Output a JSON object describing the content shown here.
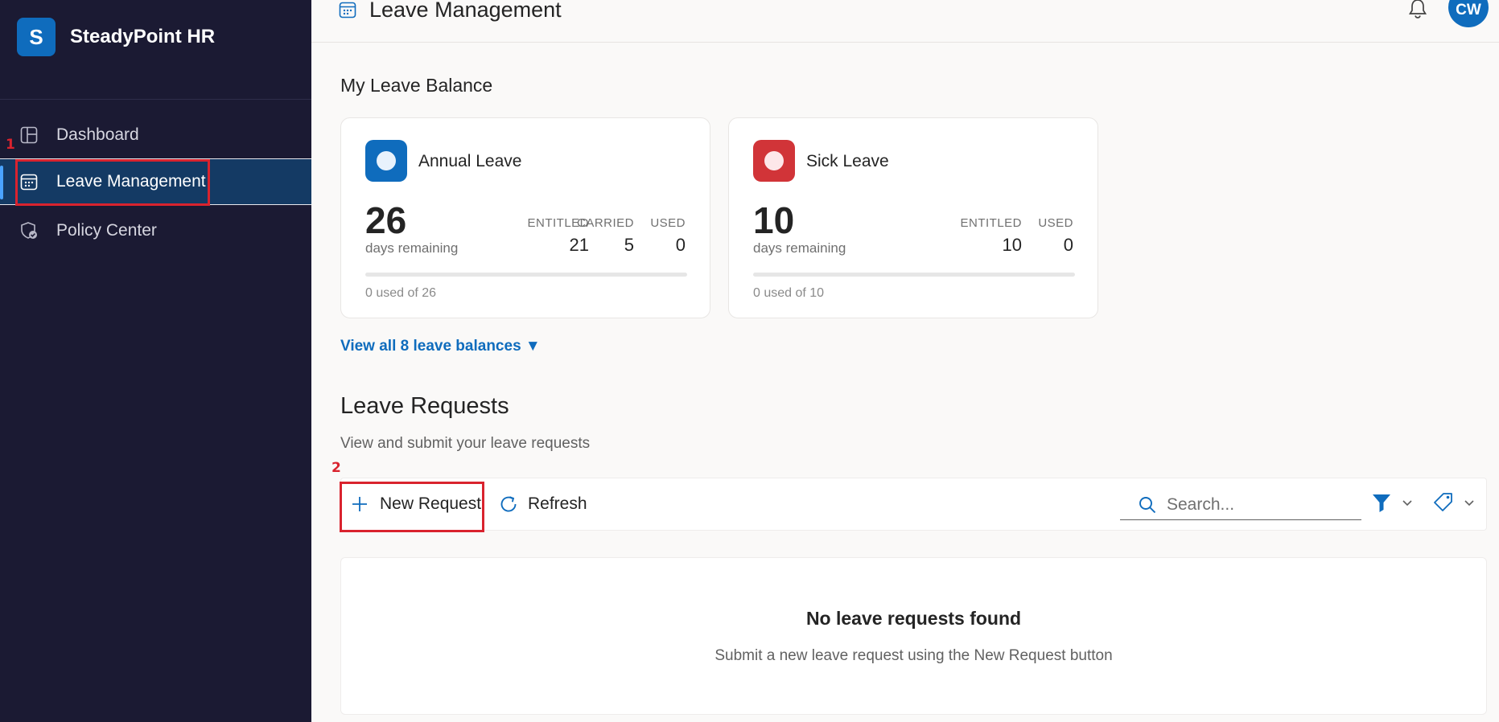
{
  "brand": {
    "logo_letter": "S",
    "name": "SteadyPoint HR"
  },
  "sidebar": {
    "items": [
      {
        "label": "Dashboard",
        "icon": "dashboard-icon"
      },
      {
        "label": "Leave Management",
        "icon": "calendar-icon",
        "active": true
      },
      {
        "label": "Policy Center",
        "icon": "shield-check-icon"
      }
    ]
  },
  "header": {
    "title": "Leave Management",
    "user_initials": "CW"
  },
  "annotations": {
    "first": "1",
    "second": "2"
  },
  "balance": {
    "title": "My Leave Balance",
    "cards": [
      {
        "name": "Annual Leave",
        "color": "#0f6cbd",
        "remaining": "26",
        "remaining_label": "days remaining",
        "stats": [
          {
            "label": "ENTITLED",
            "value": "21"
          },
          {
            "label": "CARRIED",
            "value": "5"
          },
          {
            "label": "USED",
            "value": "0"
          }
        ],
        "used_fraction": 0,
        "used_of": "0 used of 26"
      },
      {
        "name": "Sick Leave",
        "color": "#d13438",
        "remaining": "10",
        "remaining_label": "days remaining",
        "stats": [
          {
            "label": "ENTITLED",
            "value": "10"
          },
          {
            "label": "USED",
            "value": "0"
          }
        ],
        "used_fraction": 0,
        "used_of": "0 used of 10"
      }
    ],
    "view_all": "View all 8 leave balances ▼"
  },
  "requests": {
    "title": "Leave Requests",
    "subtitle": "View and submit your leave requests",
    "toolbar": {
      "new_request": "New Request",
      "refresh": "Refresh",
      "search_placeholder": "Search..."
    },
    "empty_title": "No leave requests found",
    "empty_text": "Submit a new leave request using the New Request button"
  },
  "colors": {
    "sidebar_bg": "#1b1a33",
    "accent": "#0f6cbd",
    "annotation": "#d9232e"
  }
}
